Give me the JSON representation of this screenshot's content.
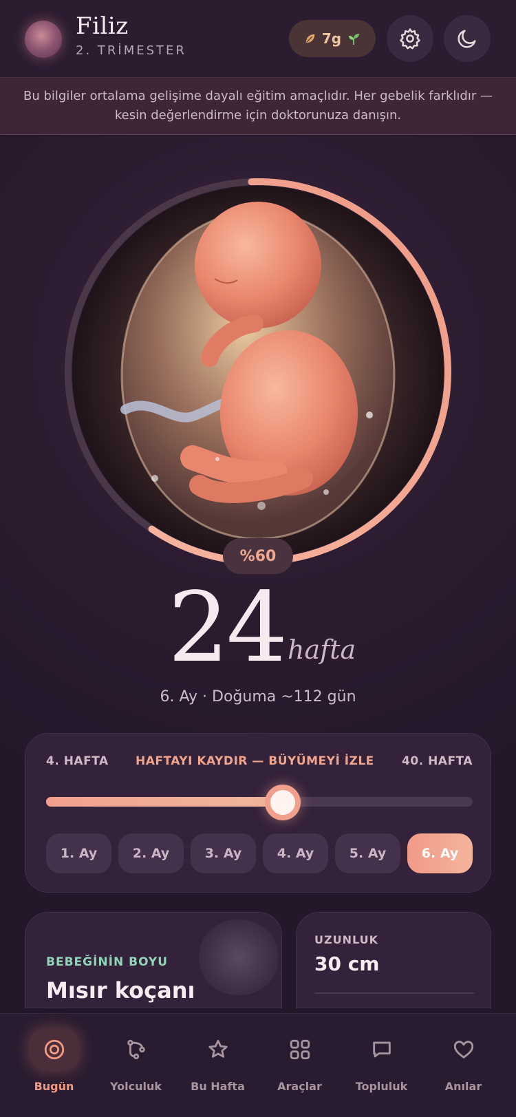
{
  "colors": {
    "accent": "#f0a08c",
    "background": "#2a1a2e",
    "card": "#33223a",
    "mint": "#8fd6b8"
  },
  "header": {
    "name": "Filiz",
    "trimester": "2. TRİMESTER",
    "streak": "7g",
    "settings_icon": "gear-icon",
    "theme_icon": "moon-icon"
  },
  "disclaimer": "Bu bilgiler ortalama gelişime dayalı eğitim amaçlıdır. Her gebelik farklıdır — kesin değerlendirme için doktorunuza danışın.",
  "progress": {
    "percent_label": "%60",
    "fraction": 0.6
  },
  "week": {
    "number": "24",
    "unit": "hafta",
    "subtitle": "6. Ay · Doğuma ~112 gün"
  },
  "slider": {
    "min_label": "4. HAFTA",
    "title": "HAFTAYI KAYDIR — BÜYÜMEYİ İZLE",
    "max_label": "40. HAFTA",
    "min": 4,
    "max": 40,
    "value": 24,
    "months": [
      "1. Ay",
      "2. Ay",
      "3. Ay",
      "4. Ay",
      "5. Ay",
      "6. Ay"
    ],
    "active_month": "6. Ay"
  },
  "size_card": {
    "label": "BEBEĞİNİN BOYU",
    "value": "Mısır koçanı"
  },
  "stat_card": {
    "length_label": "UZUNLUK",
    "length_value": "30 cm"
  },
  "nav": {
    "items": [
      {
        "label": "Bugün",
        "icon": "target-icon"
      },
      {
        "label": "Yolculuk",
        "icon": "route-icon"
      },
      {
        "label": "Bu Hafta",
        "icon": "star-icon"
      },
      {
        "label": "Araçlar",
        "icon": "grid-icon"
      },
      {
        "label": "Topluluk",
        "icon": "chat-icon"
      },
      {
        "label": "Anılar",
        "icon": "heart-icon"
      }
    ],
    "active": "Bugün"
  }
}
